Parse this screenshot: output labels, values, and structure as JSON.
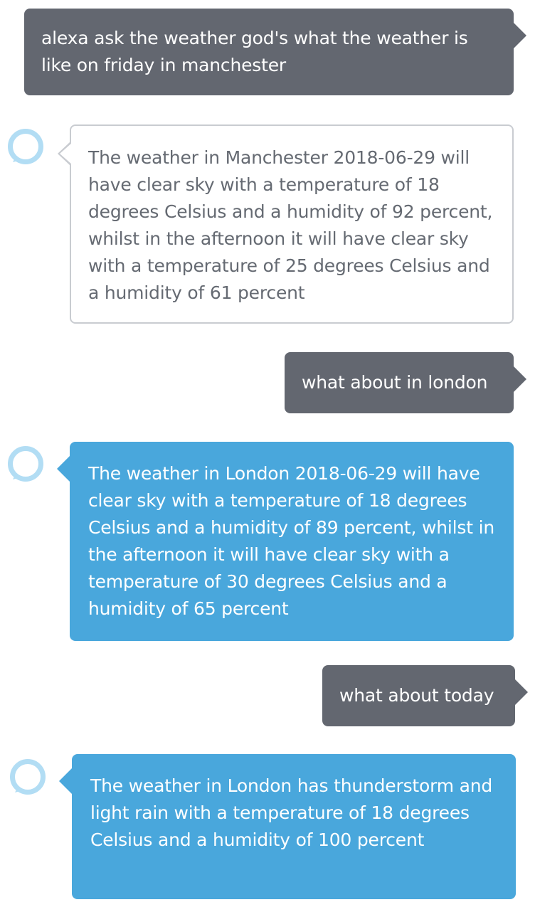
{
  "conversation": [
    {
      "speaker": "user",
      "text": "alexa ask the weather god's what the weather is like on friday in manchester"
    },
    {
      "speaker": "alexa",
      "text": "The weather in Manchester 2018-06-29 will have clear sky with a temperature of 18 degrees Celsius and a humidity of 92 percent, whilst in the afternoon it will have clear sky with a temperature of 25 degrees Celsius and a humidity of 61 percent"
    },
    {
      "speaker": "user",
      "text": "what about in london"
    },
    {
      "speaker": "alexa",
      "text": "The weather in London 2018-06-29 will have clear sky with a temperature of 18 degrees Celsius and a humidity of 89 percent, whilst in the afternoon it will have clear sky with a temperature of 30 degrees Celsius and a humidity of 65 percent"
    },
    {
      "speaker": "user",
      "text": "what about today"
    },
    {
      "speaker": "alexa",
      "text": "The weather in London has thunderstorm and light rain with a temperature of 18 degrees Celsius and a humidity of 100 percent"
    }
  ],
  "icons": {
    "alexa": "alexa-ring-icon"
  },
  "colors": {
    "user_bubble": "#636770",
    "alexa_bubble_active": "#49a7dc",
    "alexa_ring": "#b2ddf4",
    "outline_text": "#656a72"
  }
}
